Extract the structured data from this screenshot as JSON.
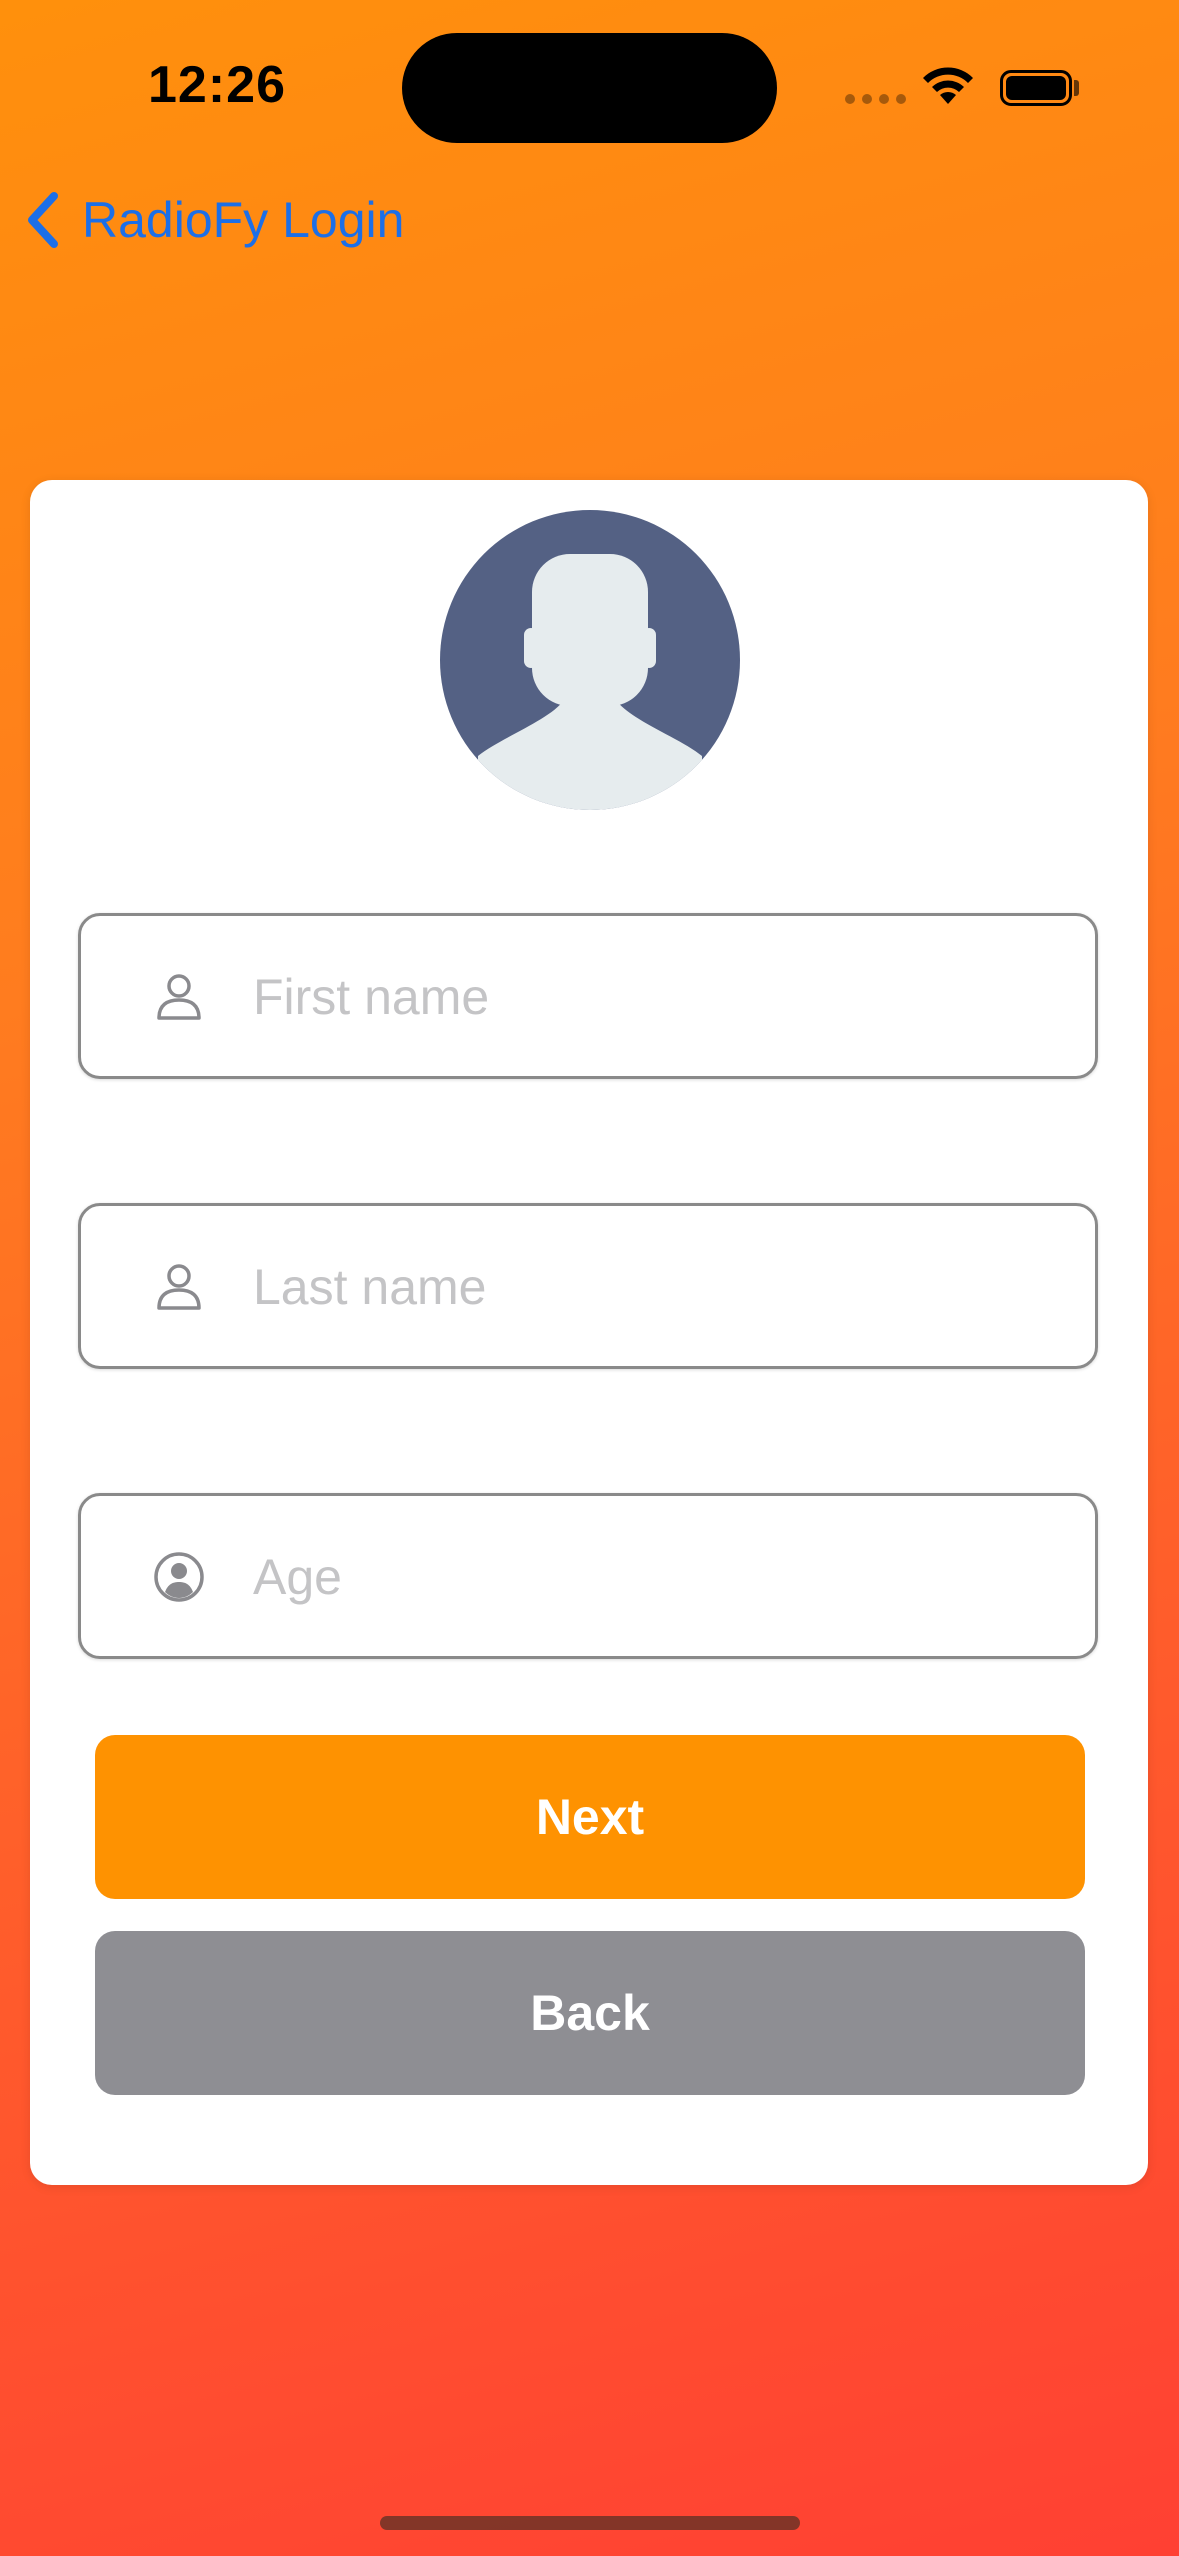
{
  "status_bar": {
    "time": "12:26"
  },
  "nav": {
    "back_label": "RadioFy Login"
  },
  "form": {
    "first_name": {
      "placeholder": "First name",
      "value": ""
    },
    "last_name": {
      "placeholder": "Last name",
      "value": ""
    },
    "age": {
      "placeholder": "Age",
      "value": ""
    }
  },
  "buttons": {
    "next": "Next",
    "back": "Back"
  },
  "icons": {
    "status": [
      "cellular-signal-icon",
      "wifi-icon",
      "battery-icon"
    ],
    "nav": "chevron-left-icon",
    "avatar": "avatar-placeholder-icon",
    "first_name": "person-icon",
    "last_name": "person-icon",
    "age": "person-circle-icon"
  },
  "colors": {
    "accent": "#fe9201",
    "link": "#1c6fe8",
    "secondary_button": "#8e8e93",
    "avatar_bg": "#546184"
  }
}
